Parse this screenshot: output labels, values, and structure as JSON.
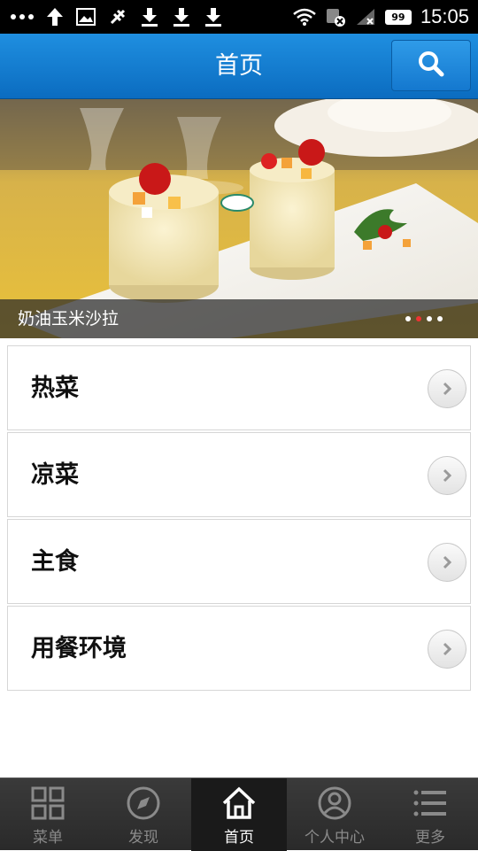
{
  "status_bar": {
    "time": "15:05",
    "battery": "99",
    "icons": [
      "more-dots-icon",
      "upload-arrow-icon",
      "image-icon",
      "usb-icon",
      "download-icon",
      "download-icon",
      "download-icon",
      "wifi-icon",
      "signal-icon",
      "battery-icon"
    ]
  },
  "header": {
    "title": "首页",
    "search_icon": "search-icon",
    "accent": "#0b6cc0"
  },
  "banner": {
    "caption": "奶油玉米沙拉",
    "slide_count": 4,
    "active_slide": 1
  },
  "menu": {
    "items": [
      {
        "label": "热菜"
      },
      {
        "label": "凉菜"
      },
      {
        "label": "主食"
      },
      {
        "label": "用餐环境"
      }
    ]
  },
  "tabbar": {
    "tabs": [
      {
        "label": "菜单",
        "icon": "grid-icon",
        "active": false
      },
      {
        "label": "发现",
        "icon": "compass-icon",
        "active": false
      },
      {
        "label": "首页",
        "icon": "home-icon",
        "active": true
      },
      {
        "label": "个人中心",
        "icon": "user-icon",
        "active": false
      },
      {
        "label": "更多",
        "icon": "list-icon",
        "active": false
      }
    ]
  }
}
